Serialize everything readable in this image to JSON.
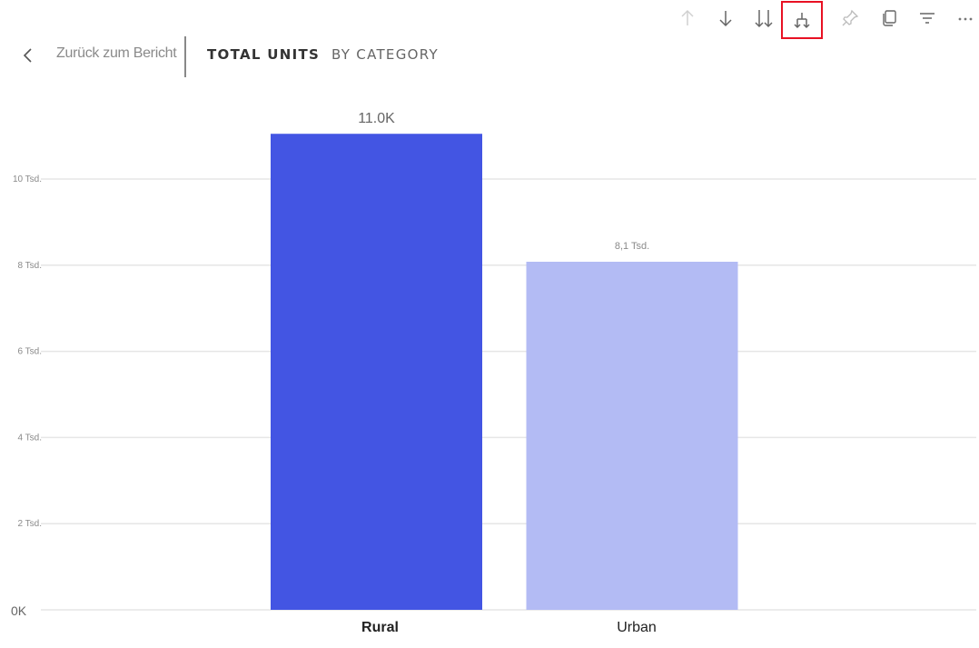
{
  "toolbar": {
    "buttons": [
      {
        "name": "drill-up-icon",
        "label": "Drill up",
        "state": "disabled"
      },
      {
        "name": "drill-down-icon",
        "label": "Drill down"
      },
      {
        "name": "expand-all-down-icon",
        "label": "Go to next level"
      },
      {
        "name": "expand-next-level-icon",
        "label": "Expand all down one level",
        "highlighted": true
      },
      {
        "name": "pin-icon",
        "label": "Pin visual"
      },
      {
        "name": "copy-icon",
        "label": "Copy"
      },
      {
        "name": "filter-icon",
        "label": "Filters"
      },
      {
        "name": "more-options-icon",
        "label": "More options"
      }
    ],
    "highlight_color": "#e81123"
  },
  "nav": {
    "back_label": "Zurück zum Bericht",
    "tab_active": "TOTAL UNITS",
    "tab_inactive": "BY CATEGORY"
  },
  "chart_data": {
    "type": "bar",
    "title": "",
    "xlabel": "",
    "ylabel": "",
    "categories": [
      "Rural",
      "Urban"
    ],
    "values": [
      11050,
      8080
    ],
    "data_labels": [
      "11.0K",
      "8,1 Tsd."
    ],
    "colors": [
      "#4355e3",
      "#b3bbf4"
    ],
    "selected_category": "Rural",
    "ylim": [
      0,
      11500
    ],
    "yticks": [
      0,
      2000,
      4000,
      6000,
      8000,
      10000
    ],
    "ytick_labels": [
      "0K",
      "2 Tsd.",
      "4 Tsd.",
      "6 Tsd.",
      "8 Tsd.",
      "10 Tsd."
    ],
    "grid": true,
    "legend": "none"
  }
}
